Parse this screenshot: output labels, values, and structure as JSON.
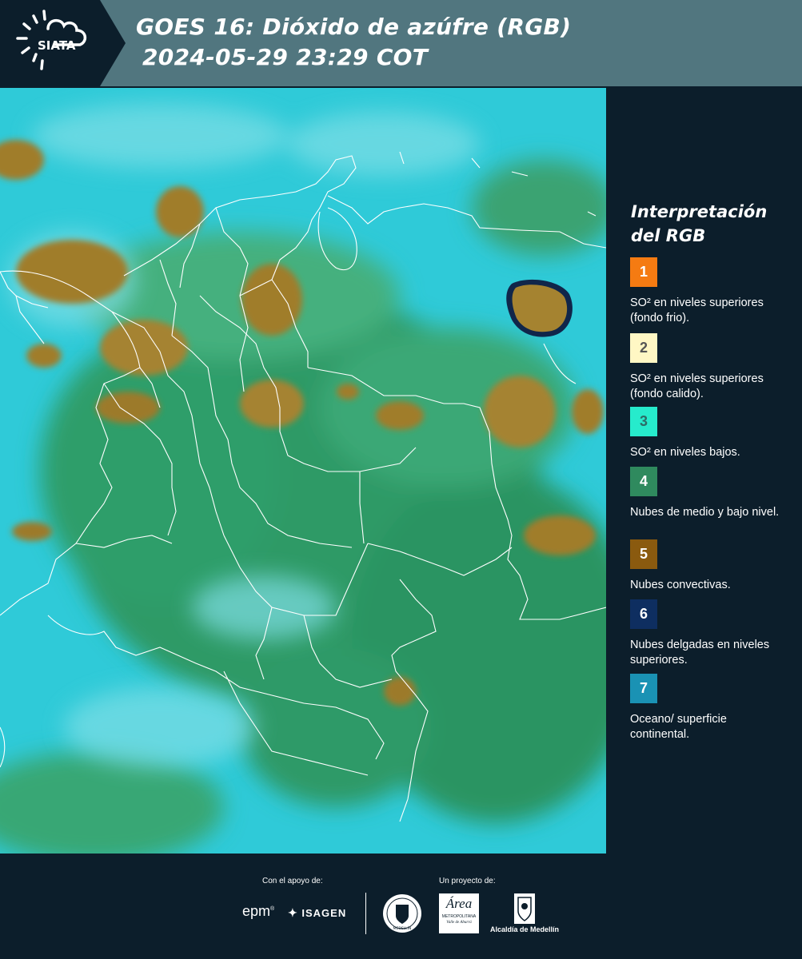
{
  "header": {
    "logo_text": "SIATA",
    "title_line1": "GOES 16: Dióxido de azúfre (RGB)",
    "title_line2": "2024-05-29 23:29 COT"
  },
  "legend": {
    "title_line1": "Interpretación",
    "title_line2": "del RGB",
    "items": [
      {
        "number": "1",
        "color": "#f57b12",
        "text_color": "#ffffff",
        "label": "SO² en niveles superiores (fondo frio)."
      },
      {
        "number": "2",
        "color": "#fff7c4",
        "text_color": "#555555",
        "label": "SO² en niveles superiores (fondo calido)."
      },
      {
        "number": "3",
        "color": "#26ebcc",
        "text_color": "#2d6b66",
        "label": "SO² en niveles bajos."
      },
      {
        "number": "4",
        "color": "#2f8a5e",
        "text_color": "#ffffff",
        "label": "Nubes de medio y bajo nivel."
      },
      {
        "number": "5",
        "color": "#8a5a0f",
        "text_color": "#ffffff",
        "label": "Nubes convectivas."
      },
      {
        "number": "6",
        "color": "#0e2e60",
        "text_color": "#ffffff",
        "label": "Nubes delgadas en niveles superiores."
      },
      {
        "number": "7",
        "color": "#1a92b4",
        "text_color": "#ffffff",
        "label": "Oceano/ superficie continental."
      }
    ]
  },
  "footer": {
    "support_label": "Con el apoyo de:",
    "project_label": "Un proyecto de:",
    "epm": "epm",
    "isagen": "ISAGEN",
    "area_title": "Área",
    "area_sub1": "METROPOLITANA",
    "area_sub2": "Valle de Aburrá",
    "alcaldia": "Alcaldía de Medellín",
    "seal_text": "MEDELLÍN"
  },
  "colors": {
    "header_bg": "#51767f",
    "dark_bg": "#0c1e2b",
    "ocean": "#2fcad8",
    "land_green": "#2f9a66",
    "convective": "#a07d2a"
  }
}
